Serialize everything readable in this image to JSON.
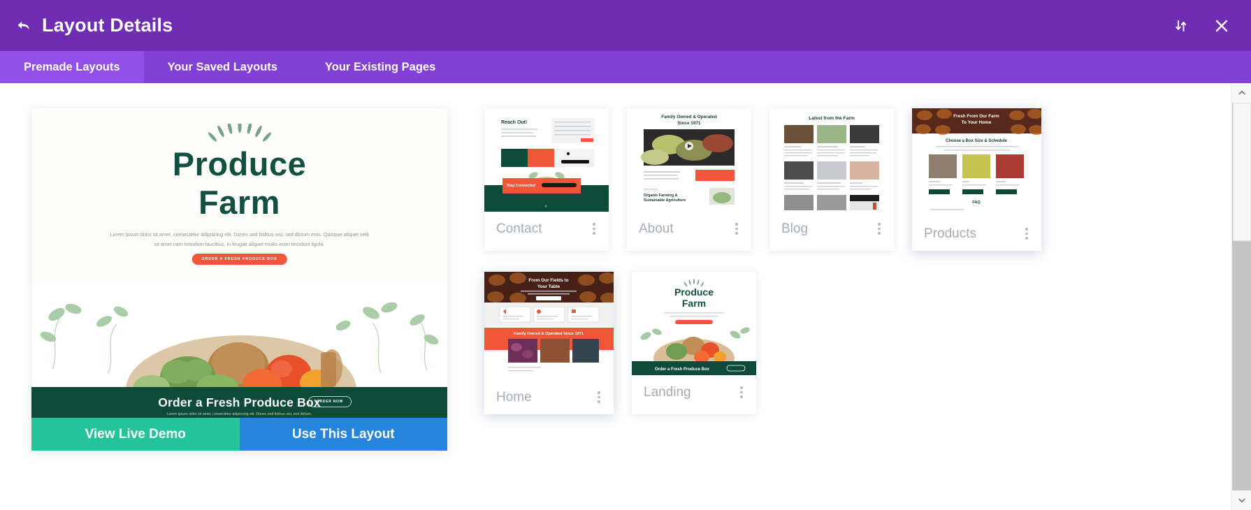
{
  "header": {
    "title": "Layout Details",
    "back_icon": "back-arrow-icon",
    "sort_icon": "sort-arrows-icon",
    "close_icon": "close-icon"
  },
  "tabs": [
    {
      "label": "Premade Layouts",
      "active": true
    },
    {
      "label": "Your Saved Layouts",
      "active": false
    },
    {
      "label": "Your Existing Pages",
      "active": false
    }
  ],
  "preview": {
    "brand_line1": "Produce",
    "brand_line2": "Farm",
    "body_text": "Lorem ipsum dolor sit amet, consectetur adipiscing elit. Donec sed finibus nisi, sed dictum eros. Quisque aliquet velit sit amet nam interdum faucibus, in feugiat aliquet mollis enim tincidunt ligula.",
    "cta_label": "ORDER A FRESH PRODUCE BOX",
    "band_title": "Order a Fresh Produce Box",
    "band_button": "ORDER NOW",
    "band_sub": "Lorem ipsum dolor sit amet, consectetur adipiscing elit. Donec sed finibus nisi, sed dictum.",
    "demo_button": "View Live Demo",
    "use_button": "Use This Layout"
  },
  "layouts": [
    {
      "name": "Contact",
      "heading": "Reach Out!",
      "menu_icon": "kebab-menu-icon"
    },
    {
      "name": "About",
      "heading": "Family Owned & Operated Since 1971",
      "menu_icon": "kebab-menu-icon"
    },
    {
      "name": "Blog",
      "heading": "Latest from the Farm",
      "menu_icon": "kebab-menu-icon"
    },
    {
      "name": "Products",
      "heading": "Fresh From Our Farm To Your Home",
      "menu_icon": "kebab-menu-icon"
    },
    {
      "name": "Home",
      "heading": "From Our Fields to Your Table",
      "menu_icon": "kebab-menu-icon"
    },
    {
      "name": "Landing",
      "heading": "Produce Farm",
      "menu_icon": "kebab-menu-icon"
    }
  ],
  "sub_headings": {
    "about_organic": "Organic Farming & Sustainable Agriculture",
    "products_choose": "Choose a Box Size & Schedule",
    "products_faq": "FAQ",
    "home_banner": "Family Owned & Operated Since 1971",
    "contact_stay": "Stay Connected",
    "landing_band": "Order a Fresh Produce Box"
  },
  "colors": {
    "header_purple": "#6f2db3",
    "tabbar_purple": "#8340d6",
    "tab_active_purple": "#9250e8",
    "brand_green": "#12503f",
    "accent_orange": "#f0573a",
    "demo_teal": "#24c49a",
    "use_blue": "#2585dd"
  },
  "scrollbar": {
    "up_icon": "chevron-up-icon",
    "down_icon": "chevron-down-icon"
  }
}
